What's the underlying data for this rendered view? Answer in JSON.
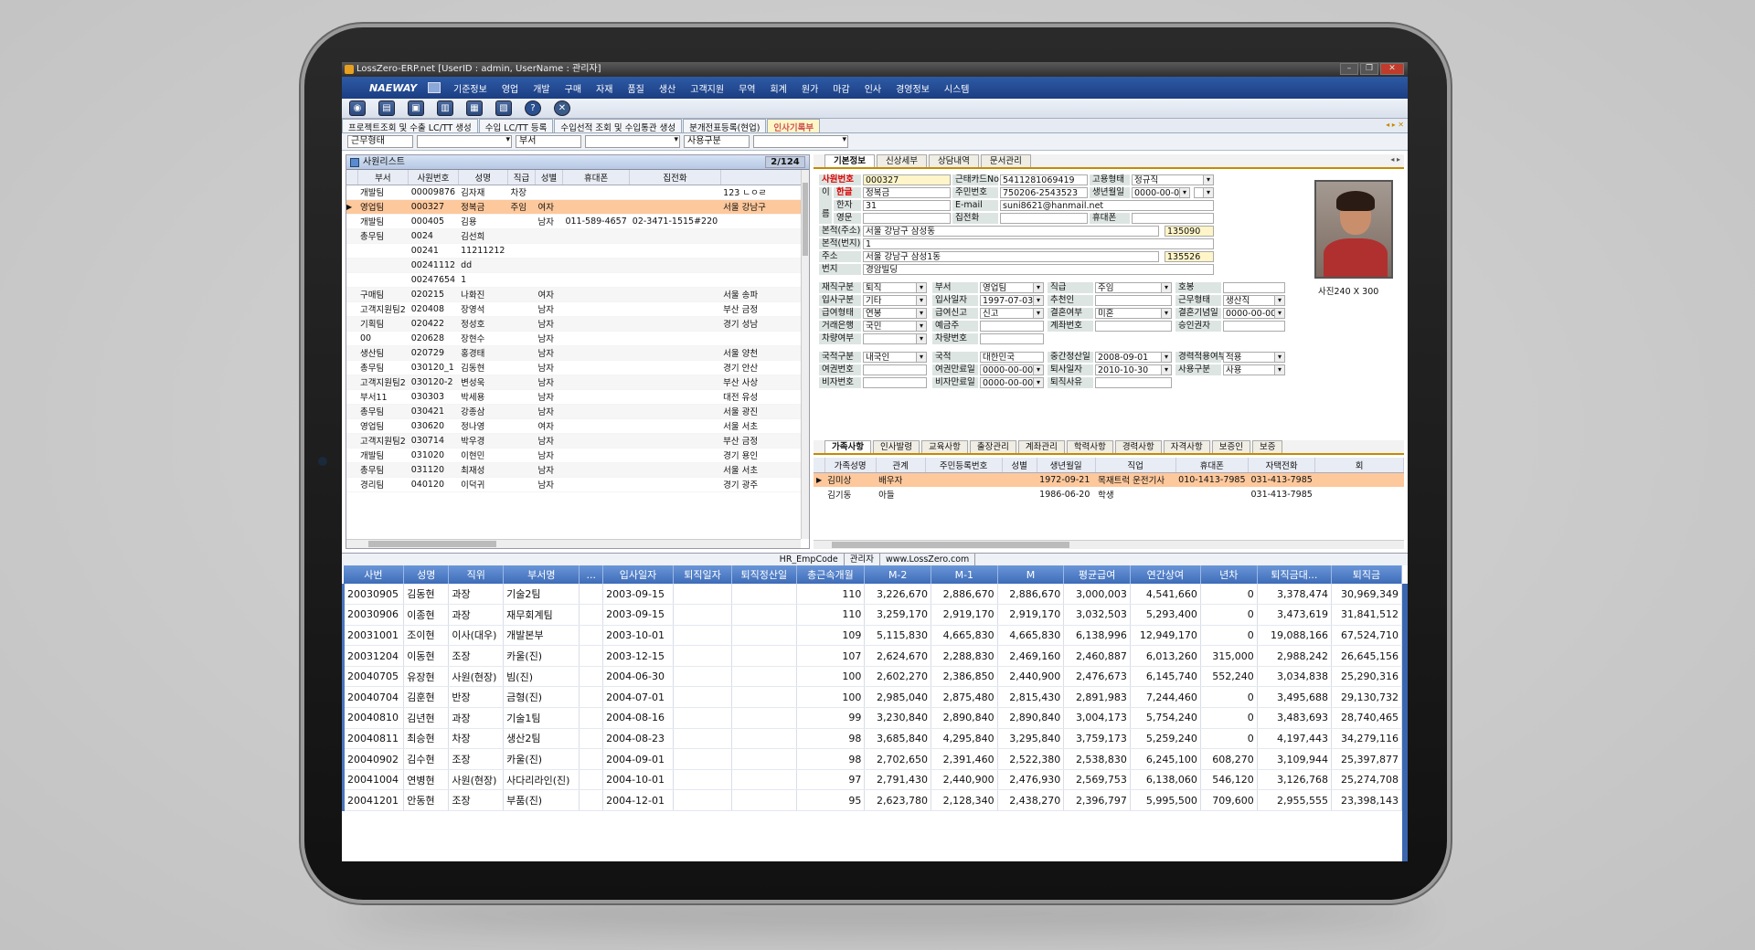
{
  "titlebar": {
    "title": "LossZero-ERP.net [UserID : admin,   UserName : 관리자]"
  },
  "menubar": {
    "brand": "NAEWAY",
    "items": [
      "기준정보",
      "영업",
      "개발",
      "구매",
      "자재",
      "품질",
      "생산",
      "고객지원",
      "무역",
      "회계",
      "원가",
      "마감",
      "인사",
      "경영정보",
      "시스템"
    ]
  },
  "toolbar": {
    "icons": [
      "mouse-icon",
      "document-icon",
      "save-icon",
      "delete-icon",
      "print-icon",
      "printer-icon",
      "help-icon",
      "close-icon"
    ]
  },
  "tabs": [
    "프로젝트조회 및 수출 LC/TT 생성",
    "수입 LC/TT 등록",
    "수입선적 조회 및 수입통관 생성",
    "분개전표등록(현업)",
    "인사기록부"
  ],
  "filters": {
    "work_type_label": "근무형태",
    "dept_label": "부서",
    "emp_type_label": "사용구분"
  },
  "left": {
    "title": "사원리스트",
    "page": "2/124",
    "columns": [
      "부서",
      "사원번호",
      "성명",
      "직급",
      "성별",
      "휴대폰",
      "집전화"
    ],
    "rows": [
      {
        "dept": "개발팀",
        "no": "00009876",
        "name": "김자재",
        "rank": "차장",
        "sex": "",
        "mobile": "",
        "home": "",
        "addr": "123 ㄴㅇㄹ"
      },
      {
        "dept": "영업팀",
        "no": "000327",
        "name": "정복금",
        "rank": "주임",
        "sex": "여자",
        "mobile": "",
        "home": "",
        "addr": "서울 강남구"
      },
      {
        "dept": "개발팀",
        "no": "000405",
        "name": "김용",
        "rank": "",
        "sex": "남자",
        "mobile": "011-589-4657",
        "home": "02-3471-1515#220",
        "addr": ""
      },
      {
        "dept": "총무팀",
        "no": "0024",
        "name": "김선희",
        "rank": "",
        "sex": "",
        "mobile": "",
        "home": "",
        "addr": ""
      },
      {
        "dept": "",
        "no": "00241",
        "name": "11211212",
        "rank": "",
        "sex": "",
        "mobile": "",
        "home": "",
        "addr": ""
      },
      {
        "dept": "",
        "no": "00241112",
        "name": "dd",
        "rank": "",
        "sex": "",
        "mobile": "",
        "home": "",
        "addr": ""
      },
      {
        "dept": "",
        "no": "00247654",
        "name": "1",
        "rank": "",
        "sex": "",
        "mobile": "",
        "home": "",
        "addr": ""
      },
      {
        "dept": "구매팀",
        "no": "020215",
        "name": "나화진",
        "rank": "",
        "sex": "여자",
        "mobile": "",
        "home": "",
        "addr": "서울 송파"
      },
      {
        "dept": "고객지원팀2",
        "no": "020408",
        "name": "장영석",
        "rank": "",
        "sex": "남자",
        "mobile": "",
        "home": "",
        "addr": "부산 금정"
      },
      {
        "dept": "기획팀",
        "no": "020422",
        "name": "정성호",
        "rank": "",
        "sex": "남자",
        "mobile": "",
        "home": "",
        "addr": "경기 성남"
      },
      {
        "dept": "00",
        "no": "020628",
        "name": "장현수",
        "rank": "",
        "sex": "남자",
        "mobile": "",
        "home": "",
        "addr": ""
      },
      {
        "dept": "생산팀",
        "no": "020729",
        "name": "홍경태",
        "rank": "",
        "sex": "남자",
        "mobile": "",
        "home": "",
        "addr": "서울 양천"
      },
      {
        "dept": "총무팀",
        "no": "030120_1",
        "name": "김동현",
        "rank": "",
        "sex": "남자",
        "mobile": "",
        "home": "",
        "addr": "경기 안산"
      },
      {
        "dept": "고객지원팀2",
        "no": "030120-2",
        "name": "변성욱",
        "rank": "",
        "sex": "남자",
        "mobile": "",
        "home": "",
        "addr": "부산 사상"
      },
      {
        "dept": "부서11",
        "no": "030303",
        "name": "박세용",
        "rank": "",
        "sex": "남자",
        "mobile": "",
        "home": "",
        "addr": "대전 유성"
      },
      {
        "dept": "총무팀",
        "no": "030421",
        "name": "강종삼",
        "rank": "",
        "sex": "남자",
        "mobile": "",
        "home": "",
        "addr": "서울 광진"
      },
      {
        "dept": "영업팀",
        "no": "030620",
        "name": "정나영",
        "rank": "",
        "sex": "여자",
        "mobile": "",
        "home": "",
        "addr": "서울 서초"
      },
      {
        "dept": "고객지원팀2",
        "no": "030714",
        "name": "박우경",
        "rank": "",
        "sex": "남자",
        "mobile": "",
        "home": "",
        "addr": "부산 금정"
      },
      {
        "dept": "개발팀",
        "no": "031020",
        "name": "이현민",
        "rank": "",
        "sex": "남자",
        "mobile": "",
        "home": "",
        "addr": "경기 용인"
      },
      {
        "dept": "총무팀",
        "no": "031120",
        "name": "최재성",
        "rank": "",
        "sex": "남자",
        "mobile": "",
        "home": "",
        "addr": "서울 서초"
      },
      {
        "dept": "경리팀",
        "no": "040120",
        "name": "이덕귀",
        "rank": "",
        "sex": "남자",
        "mobile": "",
        "home": "",
        "addr": "경기 광주"
      }
    ]
  },
  "right": {
    "tabs": [
      "기본정보",
      "신상세부",
      "상담내역",
      "문서관리"
    ],
    "form": {
      "emp_no_label": "사원번호",
      "emp_no": "000327",
      "card_label": "근태카드No",
      "card": "5411281069419",
      "emp_type_label": "고용형태",
      "emp_type": "정규직",
      "name_side_a": "이",
      "name_side_b": "름",
      "kor_label": "한글",
      "kor": "정복금",
      "ssn_label": "주민번호",
      "ssn": "750206-2543523",
      "birth_label": "생년월일",
      "birth": "0000-00-00",
      "chn_label": "한자",
      "chn": "31",
      "email_label": "E-mail",
      "email": "suni8621@hanmail.net",
      "eng_label": "영문",
      "home_label": "집전화",
      "mobile_label": "휴대폰",
      "reg_addr_label": "본적(주소)",
      "reg_addr": "서울 강남구 삼성동",
      "reg_zip": "135090",
      "reg_no_label": "본적(번지)",
      "reg_no": "1",
      "addr_label": "주소",
      "addr": "서울 강남구 삼성1동",
      "addr_zip": "135526",
      "addr_no_label": "번지",
      "addr_no": "경암빌딩",
      "status_label": "재직구분",
      "status": "퇴직",
      "dept_label": "부서",
      "dept": "영업팀",
      "rank_label": "직급",
      "rank": "주임",
      "title_label": "호봉",
      "join_type_label": "입사구분",
      "join_type": "기타",
      "join_date_label": "입사일자",
      "join_date": "1997-07-03",
      "ref_label": "추천인",
      "work_label": "근무형태",
      "work": "생산직",
      "pay_type_label": "급여형태",
      "pay_type": "연봉",
      "pay_report_label": "급여신고",
      "pay_report": "신고",
      "married_label": "결혼여부",
      "married": "미혼",
      "wedding_label": "결혼기념일",
      "wedding": "0000-00-00",
      "bank_label": "거래은행",
      "bank": "국민",
      "holder_label": "예금주",
      "account_label": "계좌번호",
      "approver_label": "승인권자",
      "car_label": "차량여부",
      "car_no_label": "차량번호",
      "nation_type_label": "국적구분",
      "nation_type": "내국인",
      "nation_label": "국적",
      "nation": "대한민국",
      "mid_settle_label": "중간정산일",
      "mid_settle": "2008-09-01",
      "career_label": "경력적용여부",
      "career": "적용",
      "passport_label": "여권번호",
      "passport_exp_label": "여권만료일",
      "passport_exp": "0000-00-00",
      "retire_date_label": "퇴사일자",
      "retire_date": "2010-10-30",
      "use_label": "사용구분",
      "use": "사용",
      "visa_label": "비자번호",
      "visa_exp_label": "비자만료일",
      "visa_exp": "0000-00-00",
      "retire_reason_label": "퇴직사유",
      "photo_caption": "사진240 X 300"
    },
    "bottom_tabs": [
      "가족사항",
      "인사발령",
      "교육사항",
      "출장관리",
      "계좌관리",
      "학력사항",
      "경력사항",
      "자격사항",
      "보증인",
      "보증"
    ],
    "family_columns": [
      "가족성명",
      "관계",
      "주민등록번호",
      "성별",
      "생년월일",
      "직업",
      "휴대폰",
      "자택전화",
      "회"
    ],
    "family": [
      {
        "name": "김미상",
        "rel": "배우자",
        "ssn": "",
        "sex": "",
        "birth": "1972-09-21",
        "job": "목재트럭 운전기사",
        "mobile": "010-1413-7985",
        "home": "031-413-7985"
      },
      {
        "name": "김기동",
        "rel": "아들",
        "ssn": "",
        "sex": "",
        "birth": "1986-06-20",
        "job": "학생",
        "mobile": "",
        "home": "031-413-7985"
      }
    ]
  },
  "statusbar": [
    "HR_EmpCode",
    "관리자",
    "www.LossZero.com"
  ],
  "grid": {
    "columns": [
      "사번",
      "성명",
      "직위",
      "부서명",
      "...",
      "입사일자",
      "퇴직일자",
      "퇴직정산일",
      "총근속개월",
      "M-2",
      "M-1",
      "M",
      "평균급여",
      "연간상여",
      "년차",
      "퇴직금대...",
      "퇴직금"
    ],
    "rows": [
      [
        "20030905",
        "김동현",
        "과장",
        "기술2팀",
        "",
        "2003-09-15",
        "",
        "",
        "110",
        "3,226,670",
        "2,886,670",
        "2,886,670",
        "3,000,003",
        "4,541,660",
        "0",
        "3,378,474",
        "30,969,349"
      ],
      [
        "20030906",
        "이종현",
        "과장",
        "재무회계팀",
        "",
        "2003-09-15",
        "",
        "",
        "110",
        "3,259,170",
        "2,919,170",
        "2,919,170",
        "3,032,503",
        "5,293,400",
        "0",
        "3,473,619",
        "31,841,512"
      ],
      [
        "20031001",
        "조이현",
        "이사(대우)",
        "개발본부",
        "",
        "2003-10-01",
        "",
        "",
        "109",
        "5,115,830",
        "4,665,830",
        "4,665,830",
        "6,138,996",
        "12,949,170",
        "0",
        "19,088,166",
        "67,524,710"
      ],
      [
        "20031204",
        "이동현",
        "조장",
        "카울(진)",
        "",
        "2003-12-15",
        "",
        "",
        "107",
        "2,624,670",
        "2,288,830",
        "2,469,160",
        "2,460,887",
        "6,013,260",
        "315,000",
        "2,988,242",
        "26,645,156"
      ],
      [
        "20040705",
        "유장현",
        "사원(현장)",
        "빔(진)",
        "",
        "2004-06-30",
        "",
        "",
        "100",
        "2,602,270",
        "2,386,850",
        "2,440,900",
        "2,476,673",
        "6,145,740",
        "552,240",
        "3,034,838",
        "25,290,316"
      ],
      [
        "20040704",
        "김훈현",
        "반장",
        "금형(진)",
        "",
        "2004-07-01",
        "",
        "",
        "100",
        "2,985,040",
        "2,875,480",
        "2,815,430",
        "2,891,983",
        "7,244,460",
        "0",
        "3,495,688",
        "29,130,732"
      ],
      [
        "20040810",
        "김년현",
        "과장",
        "기술1팀",
        "",
        "2004-08-16",
        "",
        "",
        "99",
        "3,230,840",
        "2,890,840",
        "2,890,840",
        "3,004,173",
        "5,754,240",
        "0",
        "3,483,693",
        "28,740,465"
      ],
      [
        "20040811",
        "최승현",
        "차장",
        "생산2팀",
        "",
        "2004-08-23",
        "",
        "",
        "98",
        "3,685,840",
        "4,295,840",
        "3,295,840",
        "3,759,173",
        "5,259,240",
        "0",
        "4,197,443",
        "34,279,116"
      ],
      [
        "20040902",
        "김수현",
        "조장",
        "카울(진)",
        "",
        "2004-09-01",
        "",
        "",
        "98",
        "2,702,650",
        "2,391,460",
        "2,522,380",
        "2,538,830",
        "6,245,100",
        "608,270",
        "3,109,944",
        "25,397,877"
      ],
      [
        "20041004",
        "연병현",
        "사원(현장)",
        "사다리라인(진)",
        "",
        "2004-10-01",
        "",
        "",
        "97",
        "2,791,430",
        "2,440,900",
        "2,476,930",
        "2,569,753",
        "6,138,060",
        "546,120",
        "3,126,768",
        "25,274,708"
      ],
      [
        "20041201",
        "안동현",
        "조장",
        "부품(진)",
        "",
        "2004-12-01",
        "",
        "",
        "95",
        "2,623,780",
        "2,128,340",
        "2,438,270",
        "2,396,797",
        "5,995,500",
        "709,600",
        "2,955,555",
        "23,398,143"
      ]
    ]
  }
}
